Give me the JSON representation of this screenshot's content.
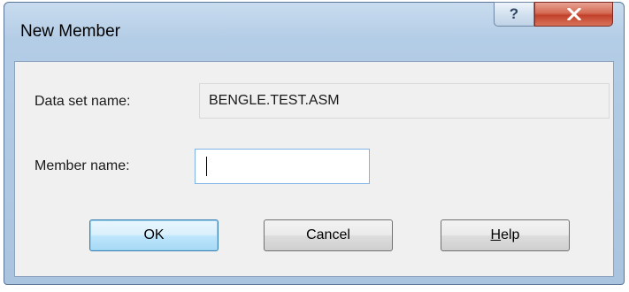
{
  "window": {
    "title": "New Member",
    "help_glyph": "?",
    "close_icon": "close-icon"
  },
  "form": {
    "dataset_label": "Data set name:",
    "dataset_value": "BENGLE.TEST.ASM",
    "member_label": "Member name:",
    "member_value": ""
  },
  "buttons": {
    "ok": "OK",
    "cancel": "Cancel",
    "help_mnemonic": "H",
    "help_rest": "elp"
  },
  "colors": {
    "title_bar": "#b4cde6",
    "close_button": "#c7432c",
    "default_button_accent": "#3c7fb1",
    "input_focus_border": "#7eb4ea"
  }
}
